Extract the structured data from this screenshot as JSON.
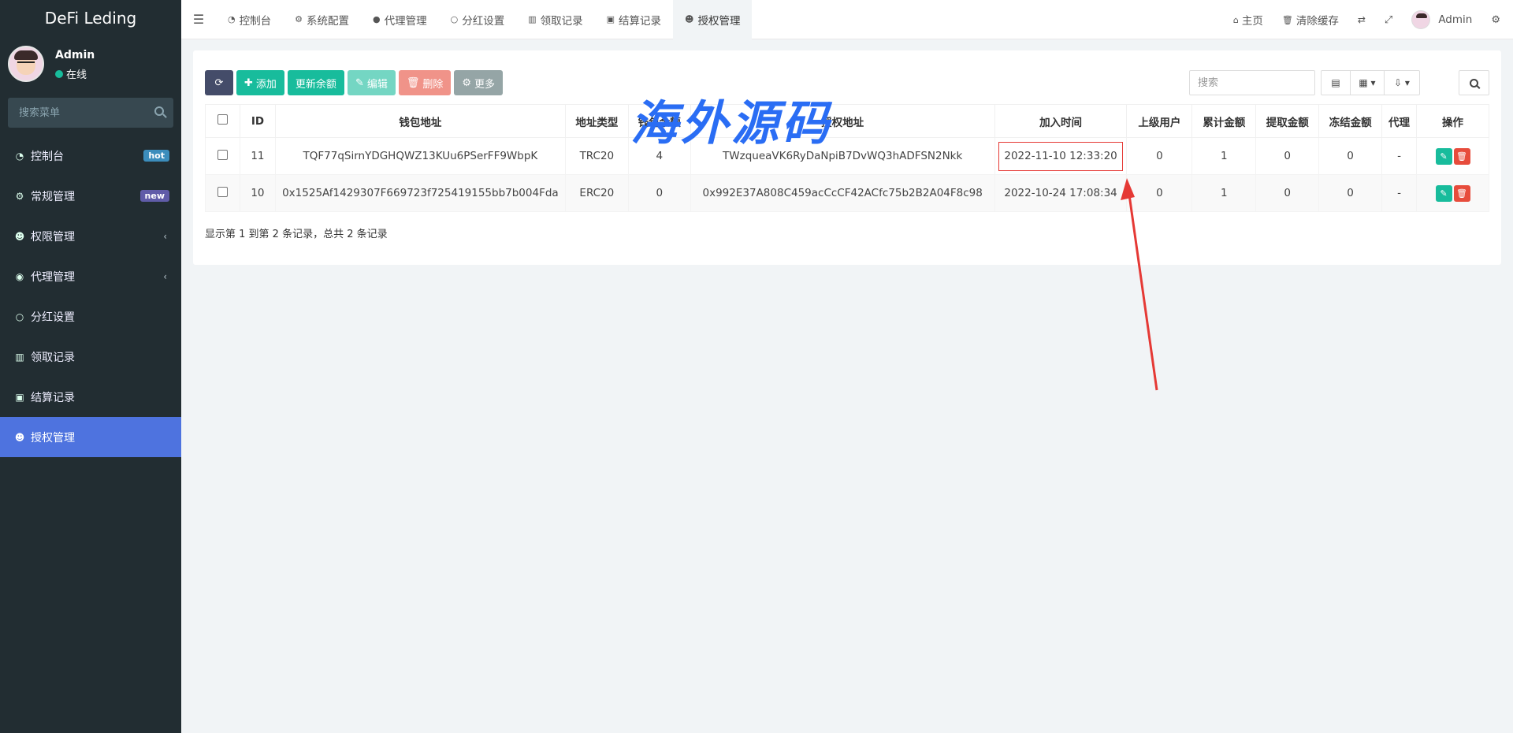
{
  "sidebar": {
    "logo": "DeFi Leding",
    "user": {
      "name": "Admin",
      "status": "在线"
    },
    "search_placeholder": "搜索菜单",
    "items": [
      {
        "label": "控制台",
        "icon": "dashboard-icon",
        "badge": "hot"
      },
      {
        "label": "常规管理",
        "icon": "cogs-icon",
        "badge": "new"
      },
      {
        "label": "权限管理",
        "icon": "users-icon",
        "chevron": "‹"
      },
      {
        "label": "代理管理",
        "icon": "user-circle-icon",
        "chevron": "‹"
      },
      {
        "label": "分红设置",
        "icon": "circle-icon"
      },
      {
        "label": "领取记录",
        "icon": "bar-icon"
      },
      {
        "label": "结算记录",
        "icon": "calc-icon"
      },
      {
        "label": "授权管理",
        "icon": "users-icon",
        "active": true
      }
    ]
  },
  "topnav": {
    "tabs": [
      {
        "label": "控制台",
        "icon": "dashboard-icon"
      },
      {
        "label": "系统配置",
        "icon": "gear-icon"
      },
      {
        "label": "代理管理",
        "icon": "user-icon"
      },
      {
        "label": "分红设置",
        "icon": "circle-icon"
      },
      {
        "label": "领取记录",
        "icon": "bar-icon"
      },
      {
        "label": "结算记录",
        "icon": "calc-icon"
      },
      {
        "label": "授权管理",
        "icon": "users-icon",
        "active": true
      }
    ],
    "right": {
      "home": "主页",
      "clear_cache": "清除缓存",
      "user": "Admin"
    }
  },
  "toolbar": {
    "add": "添加",
    "update_balance": "更新余额",
    "edit": "编辑",
    "delete": "删除",
    "more": "更多",
    "search_placeholder": "搜索"
  },
  "table": {
    "headers": [
      "ID",
      "钱包地址",
      "地址类型",
      "钱包余额",
      "授权地址",
      "加入时间",
      "上级用户",
      "累计金额",
      "提取金额",
      "冻结金额",
      "代理",
      "操作"
    ],
    "rows": [
      {
        "id": "11",
        "wallet": "TQF77qSirnYDGHQWZ13KUu6PSerFF9WbpK",
        "type": "TRC20",
        "balance": "4",
        "auth": "TWzqueaVK6RyDaNpiB7DvWQ3hADFSN2Nkk",
        "time": "2022-11-10 12:33:20",
        "parent": "0",
        "total": "1",
        "withdraw": "0",
        "frozen": "0",
        "agent": "-"
      },
      {
        "id": "10",
        "wallet": "0x1525Af1429307F669723f725419155bb7b004Fda",
        "type": "ERC20",
        "balance": "0",
        "auth": "0x992E37A808C459acCcCF42ACfc75b2B2A04F8c98",
        "time": "2022-10-24 17:08:34",
        "parent": "0",
        "total": "1",
        "withdraw": "0",
        "frozen": "0",
        "agent": "-"
      }
    ],
    "footer": "显示第 1 到第 2 条记录，总共 2 条记录"
  },
  "watermark": "海外源码",
  "colors": {
    "sidebar": "#222d32",
    "active": "#4e73df",
    "primary": "#18bc9c",
    "danger": "#e74c3c",
    "watermark": "#2a6df4",
    "arrow": "#e53935"
  }
}
